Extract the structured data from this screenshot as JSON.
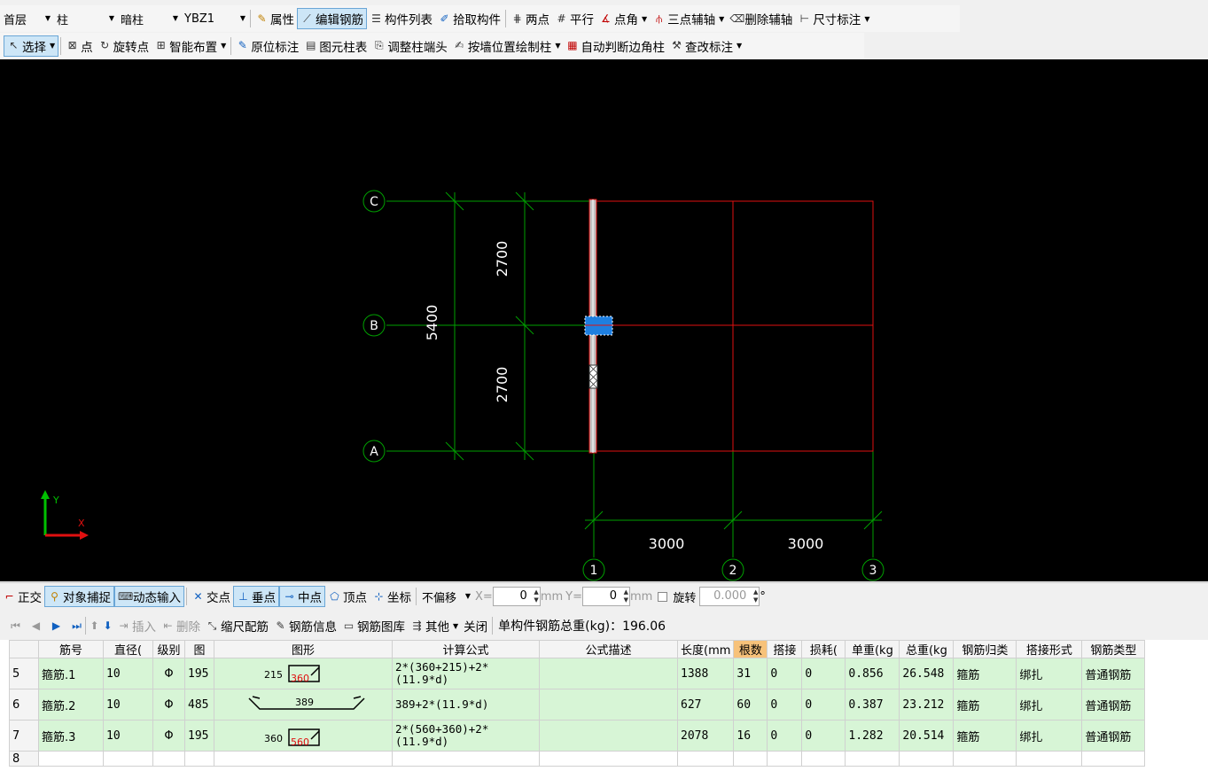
{
  "toolbar1": {
    "floor": "首层",
    "category": "柱",
    "type": "暗柱",
    "member": "YBZ1",
    "buttons": [
      "属性",
      "编辑钢筋",
      "构件列表",
      "拾取构件",
      "两点",
      "平行",
      "点角",
      "三点辅轴",
      "删除辅轴",
      "尺寸标注"
    ]
  },
  "toolbar2": {
    "buttons": [
      "选择",
      "点",
      "旋转点",
      "智能布置",
      "原位标注",
      "图元柱表",
      "调整柱端头",
      "按墙位置绘制柱",
      "自动判断边角柱",
      "查改标注"
    ]
  },
  "drawing": {
    "axes_rows": [
      "C",
      "B",
      "A"
    ],
    "axes_cols": [
      "1",
      "2",
      "3"
    ],
    "dims_vertical": [
      "2700",
      "2700"
    ],
    "dim_total": "5400",
    "dims_horizontal": [
      "3000",
      "3000"
    ],
    "ucs": {
      "x": "X",
      "y": "Y"
    },
    "colors": {
      "grid": "#00a000",
      "red": "#e01010",
      "blue": "#1e7fe0"
    }
  },
  "toolbar3": {
    "buttons": [
      "正交",
      "对象捕捉",
      "动态输入",
      "交点",
      "垂点",
      "中点",
      "顶点",
      "坐标"
    ],
    "offset": "不偏移",
    "x_label": "X=",
    "x_value": "0",
    "unit1": "mm",
    "y_label": "Y=",
    "y_value": "0",
    "unit2": "mm",
    "rotate": "旋转",
    "rotate_value": "0.000",
    "deg": "°"
  },
  "toolbar4": {
    "buttons": [
      "插入",
      "删除",
      "缩尺配筋",
      "钢筋信息",
      "钢筋图库",
      "其他",
      "关闭"
    ],
    "total": "单构件钢筋总重(kg)：196.06"
  },
  "table": {
    "headers": [
      "",
      "筋号",
      "直径(",
      "级别",
      "图",
      "图形",
      "计算公式",
      "公式描述",
      "长度(mm",
      "根数",
      "搭接",
      "损耗(",
      "单重(kg",
      "总重(kg",
      "钢筋归类",
      "搭接形式",
      "钢筋类型"
    ],
    "rows": [
      {
        "n": "5",
        "name": "箍筋.1",
        "dia": "10",
        "grade": "Φ",
        "fig": "195",
        "s1": "215",
        "s2": "360",
        "formula": "2*(360+215)+2*(11.9*d)",
        "desc": "",
        "len": "1388",
        "cnt": "31",
        "lap": "0",
        "loss": "0",
        "unit": "0.856",
        "total": "26.548",
        "cls": "箍筋",
        "lapform": "绑扎",
        "rtype": "普通钢筋"
      },
      {
        "n": "6",
        "name": "箍筋.2",
        "dia": "10",
        "grade": "Φ",
        "fig": "485",
        "s1": "389",
        "s2": "",
        "formula": "389+2*(11.9*d)",
        "desc": "",
        "len": "627",
        "cnt": "60",
        "lap": "0",
        "loss": "0",
        "unit": "0.387",
        "total": "23.212",
        "cls": "箍筋",
        "lapform": "绑扎",
        "rtype": "普通钢筋"
      },
      {
        "n": "7",
        "name": "箍筋.3",
        "dia": "10",
        "grade": "Φ",
        "fig": "195",
        "s1": "360",
        "s2": "560",
        "formula": "2*(560+360)+2*(11.9*d)",
        "desc": "",
        "len": "2078",
        "cnt": "16",
        "lap": "0",
        "loss": "0",
        "unit": "1.282",
        "total": "20.514",
        "cls": "箍筋",
        "lapform": "绑扎",
        "rtype": "普通钢筋"
      }
    ],
    "empty_row": "8"
  }
}
